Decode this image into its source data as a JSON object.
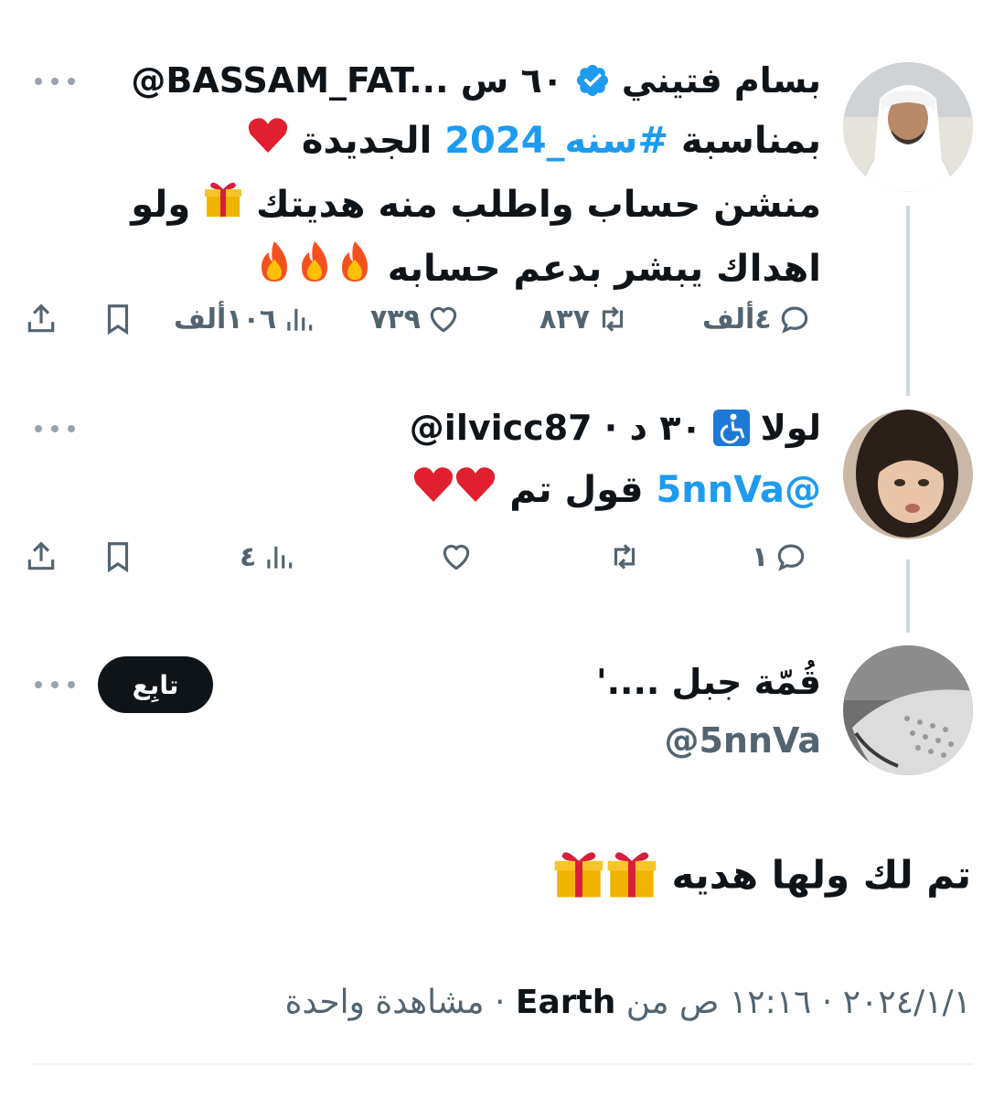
{
  "colors": {
    "accent": "#1d9bf0",
    "text": "#0f1419",
    "muted": "#536471",
    "verified": "#1d9bf0"
  },
  "tweet1": {
    "name": "بسام فتيني",
    "handle_time": "@BASSAM_FAT... ٦٠ س",
    "line1_prefix": "بمناسبة ",
    "hashtag": "#سنه_2024",
    "line1_suffix": " الجديدة",
    "line2": "منشن حساب واطلب منه هديتك",
    "line2_suffix": " ولو",
    "line3": "اهداك يبشر بدعم حسابه",
    "actions": {
      "replies": "٤ألف",
      "retweets": "٨٣٧",
      "likes": "٧٣٩",
      "views": "١٠٦ألف"
    }
  },
  "tweet2": {
    "name": "لولا",
    "handle_time": "@ilvicc87 · ٣٠ د",
    "mention": "@5nnVa",
    "text": " قول تم ",
    "actions": {
      "replies": "١",
      "retweets": "",
      "likes": "",
      "views": "٤"
    }
  },
  "tweet3": {
    "name": "قُمّة جبل ....'",
    "handle": "@5nnVa",
    "follow_label": "تابِع",
    "text": "تم لك ولها هديه",
    "meta_date": "٢٠٢٤/١/١ · ١٢:١٦ ص من ",
    "meta_place": "Earth",
    "meta_views": " · مشاهدة واحدة"
  }
}
